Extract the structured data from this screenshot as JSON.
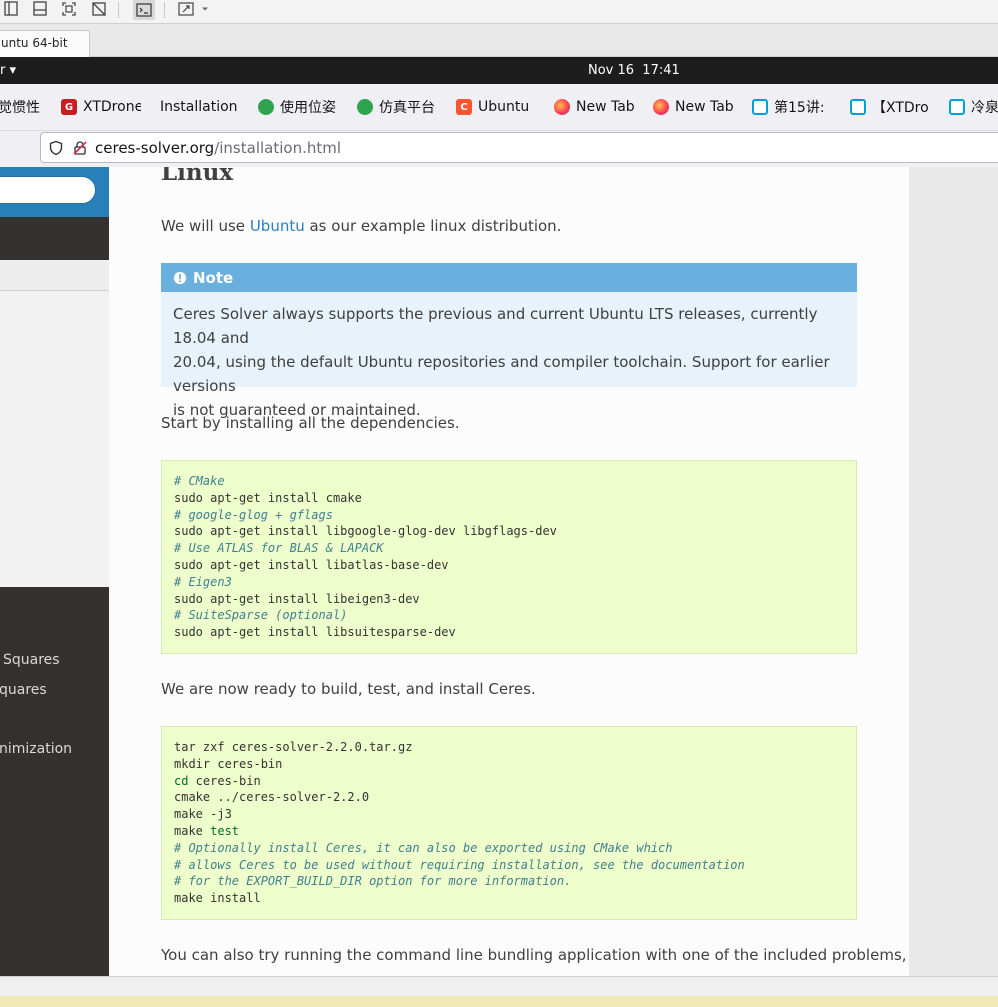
{
  "vm": {
    "tab_title": "untu 64-bit"
  },
  "topbar": {
    "activities": "r ▾",
    "clock": "Nov 16  17:41"
  },
  "bookmarks": [
    {
      "label": "觉惯性",
      "icon": "bookmark-favicon"
    },
    {
      "label": "XTDrone",
      "icon": "gitee-icon",
      "color": "#c71d23"
    },
    {
      "label": "Installation",
      "icon": "none"
    },
    {
      "label": "使用位姿",
      "icon": "green-globe-icon",
      "color": "#2ea44f"
    },
    {
      "label": "仿真平台",
      "icon": "green-globe-icon",
      "color": "#2ea44f"
    },
    {
      "label": "Ubuntu",
      "icon": "csdn-icon",
      "color": "#fc5531"
    },
    {
      "label": "New Tab",
      "icon": "firefox-icon",
      "color": "#ff7139"
    },
    {
      "label": "New Tab",
      "icon": "firefox-icon",
      "color": "#ff7139"
    },
    {
      "label": "第15讲:",
      "icon": "bilibili-icon",
      "color": "#00a1d6"
    },
    {
      "label": "【XTDro",
      "icon": "bilibili-icon",
      "color": "#00a1d6"
    },
    {
      "label": "冷泉",
      "icon": "bilibili-icon",
      "color": "#00a1d6"
    }
  ],
  "urlbar": {
    "host": "ceres-solver.org",
    "path": "/installation.html"
  },
  "sidebar": {
    "items": [
      "Squares",
      "quares",
      "nimization"
    ]
  },
  "content": {
    "heading": "Linux",
    "intro_pre": "We will use ",
    "intro_link": "Ubuntu",
    "intro_post": " as our example linux distribution.",
    "note_title": "Note",
    "note_lines": [
      "Ceres Solver always supports the previous and current Ubuntu LTS releases, currently 18.04 and",
      "20.04, using the default Ubuntu repositories and compiler toolchain. Support for earlier versions",
      "is not guaranteed or maintained."
    ],
    "deps_text": "Start by installing all the dependencies.",
    "code1": [
      {
        "t": "# CMake",
        "s": "comment"
      },
      {
        "t": "sudo apt-get install cmake",
        "s": "plain"
      },
      {
        "t": "# google-glog + gflags",
        "s": "comment"
      },
      {
        "t": "sudo apt-get install libgoogle-glog-dev libgflags-dev",
        "s": "plain"
      },
      {
        "t": "# Use ATLAS for BLAS & LAPACK",
        "s": "comment"
      },
      {
        "t": "sudo apt-get install libatlas-base-dev",
        "s": "plain"
      },
      {
        "t": "# Eigen3",
        "s": "comment"
      },
      {
        "t": "sudo apt-get install libeigen3-dev",
        "s": "plain"
      },
      {
        "t": "# SuiteSparse (optional)",
        "s": "comment"
      },
      {
        "t": "sudo apt-get install libsuitesparse-dev",
        "s": "plain"
      }
    ],
    "build_text": "We are now ready to build, test, and install Ceres.",
    "code2": [
      {
        "t": "tar zxf ceres-solver-2.2.0.tar.gz",
        "s": "plain"
      },
      {
        "t": "mkdir ceres-bin",
        "s": "plain"
      },
      {
        "kw": "cd",
        "t": " ceres-bin",
        "s": "kw"
      },
      {
        "t": "cmake ../ceres-solver-2.2.0",
        "s": "plain"
      },
      {
        "t": "make -j3",
        "s": "plain"
      },
      {
        "pre": "make ",
        "kw": "test",
        "s": "kwpost"
      },
      {
        "t": "# Optionally install Ceres, it can also be exported using CMake which",
        "s": "comment"
      },
      {
        "t": "# allows Ceres to be used without requiring installation, see the documentation",
        "s": "comment"
      },
      {
        "t": "# for the EXPORT_BUILD_DIR option for more information.",
        "s": "comment"
      },
      {
        "t": "make install",
        "s": "plain"
      }
    ],
    "bundle_text": "You can also try running the command line bundling application with one of the included problems,"
  }
}
